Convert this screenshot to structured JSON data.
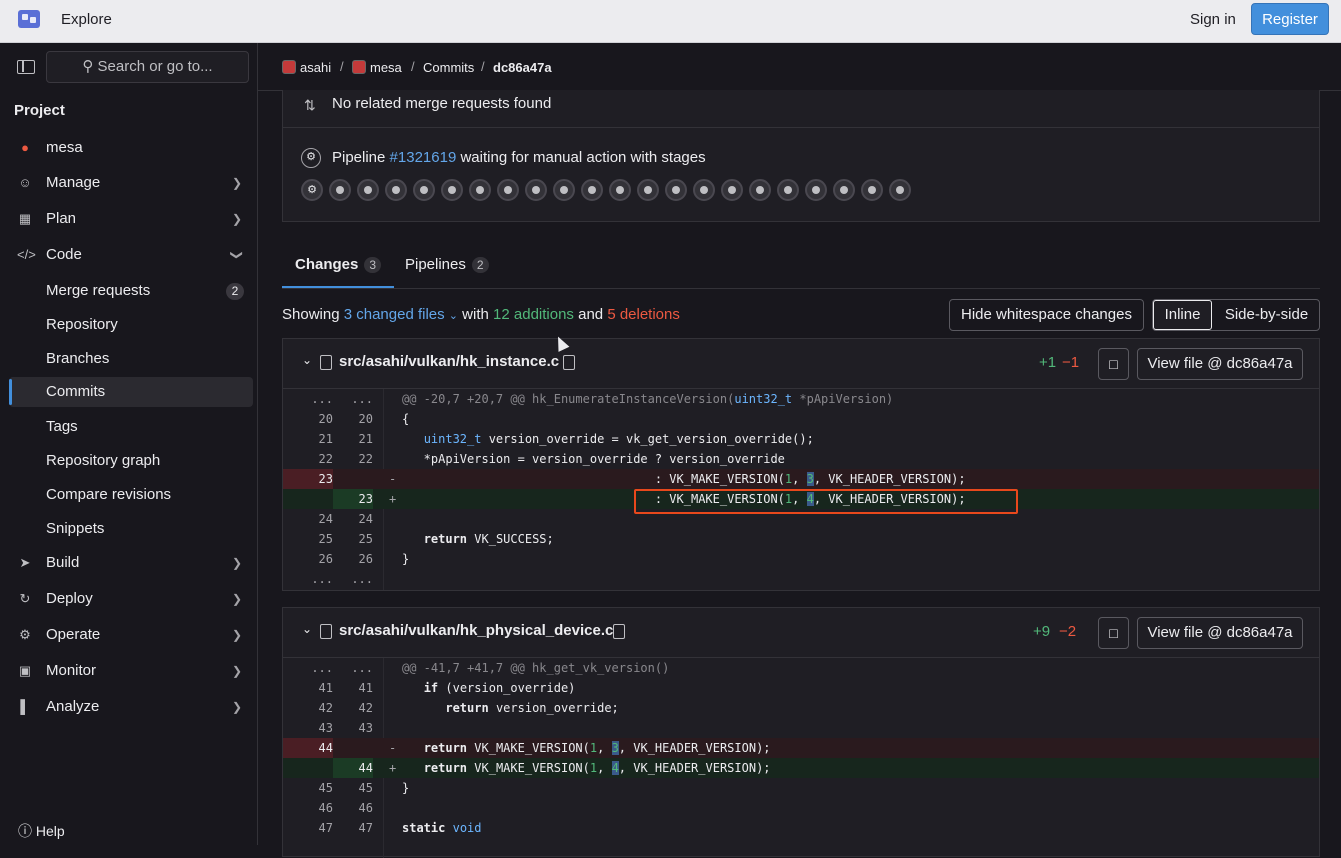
{
  "topbar": {
    "explore": "Explore",
    "sign_in": "Sign in",
    "register": "Register"
  },
  "sidebar": {
    "search_placeholder": "Search or go to...",
    "section": "Project",
    "project_name": "mesa",
    "items": [
      {
        "label": "Manage"
      },
      {
        "label": "Plan"
      },
      {
        "label": "Code"
      },
      {
        "label": "Merge requests",
        "badge": "2"
      },
      {
        "label": "Repository"
      },
      {
        "label": "Branches"
      },
      {
        "label": "Commits"
      },
      {
        "label": "Tags"
      },
      {
        "label": "Repository graph"
      },
      {
        "label": "Compare revisions"
      },
      {
        "label": "Snippets"
      },
      {
        "label": "Build"
      },
      {
        "label": "Deploy"
      },
      {
        "label": "Operate"
      },
      {
        "label": "Monitor"
      },
      {
        "label": "Analyze"
      }
    ],
    "help": "Help"
  },
  "breadcrumb": [
    "asahi",
    "mesa",
    "Commits",
    "dc86a47a"
  ],
  "info": {
    "mr_text": "No related merge requests found",
    "pipeline_prefix": "Pipeline ",
    "pipeline_id": "#1321619",
    "pipeline_suffix": " waiting for manual action with stages"
  },
  "tabs": {
    "changes": "Changes",
    "changes_count": "3",
    "pipelines": "Pipelines",
    "pipelines_count": "2"
  },
  "summary": {
    "showing": "Showing ",
    "changed_files": "3 changed files",
    "with": " with ",
    "additions": "12 additions",
    "and": " and ",
    "deletions": "5 deletions"
  },
  "controls": {
    "hide_ws": "Hide whitespace changes",
    "inline": "Inline",
    "side_by_side": "Side-by-side"
  },
  "files": [
    {
      "name": "src/asahi/vulkan/hk_instance.c",
      "added": "+1",
      "removed": "−1",
      "view_label": "View file @ dc86a47a",
      "lines": [
        {
          "o": "...",
          "n": "...",
          "t": "hunk",
          "c": "@@ -20,7 +20,7 @@ hk_EnumerateInstanceVersion(uint32_t *pApiVersion)"
        },
        {
          "o": "20",
          "n": "20",
          "t": "ctx",
          "c": "{"
        },
        {
          "o": "21",
          "n": "21",
          "t": "ctx",
          "c": "   uint32_t version_override = vk_get_version_override();"
        },
        {
          "o": "22",
          "n": "22",
          "t": "ctx",
          "c": "   *pApiVersion = version_override ? version_override"
        },
        {
          "o": "23",
          "n": "",
          "t": "del",
          "c": "                                   : VK_MAKE_VERSION(1, 3, VK_HEADER_VERSION);"
        },
        {
          "o": "",
          "n": "23",
          "t": "add",
          "c": "                                   : VK_MAKE_VERSION(1, 4, VK_HEADER_VERSION);"
        },
        {
          "o": "24",
          "n": "24",
          "t": "ctx",
          "c": ""
        },
        {
          "o": "25",
          "n": "25",
          "t": "ctx",
          "c": "   return VK_SUCCESS;"
        },
        {
          "o": "26",
          "n": "26",
          "t": "ctx",
          "c": "}"
        },
        {
          "o": "...",
          "n": "...",
          "t": "ctx",
          "c": ""
        }
      ]
    },
    {
      "name": "src/asahi/vulkan/hk_physical_device.c",
      "added": "+9",
      "removed": "−2",
      "view_label": "View file @ dc86a47a",
      "lines": [
        {
          "o": "...",
          "n": "...",
          "t": "hunk",
          "c": "@@ -41,7 +41,7 @@ hk_get_vk_version()"
        },
        {
          "o": "41",
          "n": "41",
          "t": "ctx",
          "c": "   if (version_override)"
        },
        {
          "o": "42",
          "n": "42",
          "t": "ctx",
          "c": "      return version_override;"
        },
        {
          "o": "43",
          "n": "43",
          "t": "ctx",
          "c": ""
        },
        {
          "o": "44",
          "n": "",
          "t": "del",
          "c": "   return VK_MAKE_VERSION(1, 3, VK_HEADER_VERSION);"
        },
        {
          "o": "",
          "n": "44",
          "t": "add",
          "c": "   return VK_MAKE_VERSION(1, 4, VK_HEADER_VERSION);"
        },
        {
          "o": "45",
          "n": "45",
          "t": "ctx",
          "c": "}"
        },
        {
          "o": "46",
          "n": "46",
          "t": "ctx",
          "c": ""
        },
        {
          "o": "47",
          "n": "47",
          "t": "ctx",
          "c": "static void"
        }
      ]
    }
  ]
}
